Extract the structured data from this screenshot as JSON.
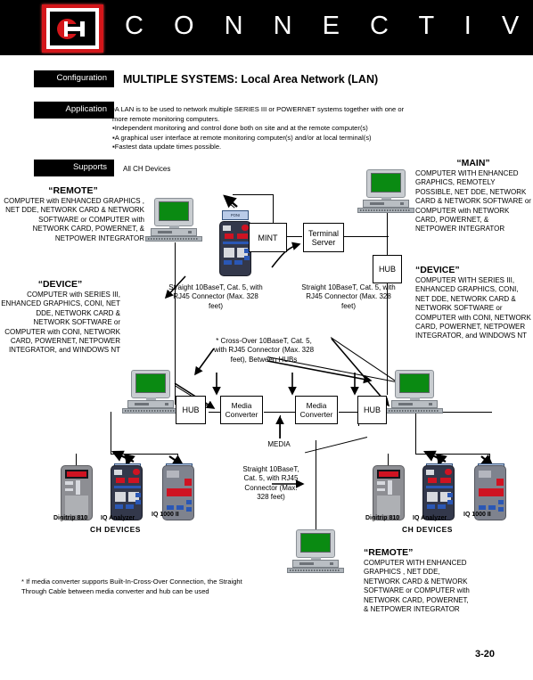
{
  "header": {
    "logo_letters": "CH",
    "title": "C O N N E C T I V I T Y"
  },
  "tags": {
    "configuration": "Configuration",
    "application": "Application",
    "supports": "Supports"
  },
  "configuration": {
    "heading": "MULTIPLE SYSTEMS: Local Area Network (LAN)"
  },
  "application": {
    "bullets": [
      "▪A LAN is to be used to network multiple SERIES III or POWERNET  systems  together  with one or",
      "   more remote monitoring computers.",
      "▪Independent monitoring and control done both on site and at the remote computer(s)",
      "▪A graphical user interface at remote monitoring computer(s) and/or at local terminal(s)",
      "▪Fastest data update times possible."
    ]
  },
  "supports": {
    "value": "All CH Devices"
  },
  "blocks": {
    "remote_left": {
      "heading": "“REMOTE”",
      "body": "COMPUTER with ENHANCED GRAPHICS , NET DDE, NETWORK CARD & NETWORK SOFTWARE or COMPUTER with NETWORK CARD, POWERNET, & NETPOWER INTEGRATOR"
    },
    "device_left": {
      "heading": "“DEVICE”",
      "body": "COMPUTER with SERIES III, ENHANCED GRAPHICS, CONI, NET DDE, NETWORK CARD & NETWORK SOFTWARE or COMPUTER with CONI, NETWORK CARD, POWERNET, NETPOWER INTEGRATOR, and WINDOWS NT"
    },
    "main_right": {
      "heading": "“MAIN”",
      "body": "COMPUTER WITH ENHANCED GRAPHICS, REMOTELY POSSIBLE, NET DDE, NETWORK CARD & NETWORK SOFTWARE or COMPUTER with NETWORK CARD, POWERNET, & NETPOWER INTEGRATOR"
    },
    "device_right": {
      "heading": "“DEVICE”",
      "body": "COMPUTER WITH SERIES III, ENHANCED GRAPHICS, CONI, NET DDE, NETWORK CARD & NETWORK SOFTWARE or COMPUTER with CONI, NETWORK CARD, POWERNET, NETPOWER INTEGRATOR, and WINDOWS NT"
    },
    "remote_bottom": {
      "heading": "“REMOTE”",
      "body": "COMPUTER WITH ENHANCED GRAPHICS , NET DDE, NETWORK CARD & NETWORK SOFTWARE or COMPUTER with NETWORK CARD, POWERNET, & NETPOWER INTEGRATOR"
    }
  },
  "cables": {
    "straight_left": "Straight 10BaseT, Cat. 5, with RJ45 Connector  (Max. 328 feet)",
    "straight_right": "Straight 10BaseT, Cat. 5, with RJ45 Connector  (Max. 328 feet)",
    "crossover": "* Cross-Over 10BaseT, Cat. 5, with RJ45 Connector  (Max. 328 feet), Between HUBs",
    "straight_bottom": "Straight 10BaseT, Cat. 5, with RJ45 Connector (Max. 328 feet)"
  },
  "nodes": {
    "mint": "MINT",
    "terminal_server": "Terminal Server",
    "hub": "HUB",
    "media_converter": "Media Converter",
    "media_label": "MEDIA"
  },
  "devices": {
    "poni_label": "PONI",
    "left": {
      "items": [
        "Digitrip 810",
        "IQ Analyzer",
        "IQ 1000 II"
      ],
      "group": "CH  DEVICES"
    },
    "right": {
      "items": [
        "Digitrip 810",
        "IQ Analyzer",
        "IQ 1000 II"
      ],
      "group": "CH  DEVICES"
    }
  },
  "footnote": "* If media converter supports Built-In-Cross-Over Connection, the Straight Through Cable between media converter and hub can be used",
  "page_number": "3-20"
}
